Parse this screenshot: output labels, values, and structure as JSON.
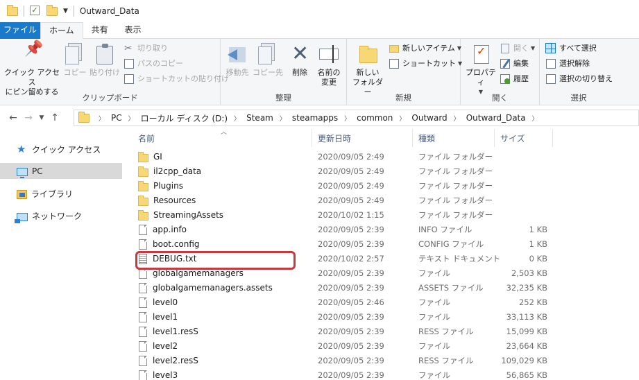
{
  "window": {
    "title": "Outward_Data"
  },
  "tabs": [
    {
      "label": "ファイル",
      "kind": "file"
    },
    {
      "label": "ホーム",
      "kind": "active"
    },
    {
      "label": "共有",
      "kind": ""
    },
    {
      "label": "表示",
      "kind": ""
    }
  ],
  "ribbon": {
    "clipboard": {
      "label": "クリップボード",
      "pin_line1": "クイック アクセス",
      "pin_line2": "にピン留めする",
      "copy": "コピー",
      "paste": "貼り付け",
      "cut": "切り取り",
      "copy_path": "パスのコピー",
      "paste_shortcut": "ショートカットの貼り付け"
    },
    "organize": {
      "label": "整理",
      "move_to": "移動先",
      "copy_to": "コピー先",
      "delete": "削除",
      "rename_line1": "名前の",
      "rename_line2": "変更"
    },
    "new": {
      "label": "新規",
      "new_folder_line1": "新しい",
      "new_folder_line2": "フォルダー",
      "new_item": "新しいアイテム",
      "shortcut": "ショートカット"
    },
    "open": {
      "label": "開く",
      "properties": "プロパティ",
      "open": "開く",
      "edit": "編集",
      "history": "履歴"
    },
    "select": {
      "label": "選択",
      "select_all": "すべて選択",
      "select_none": "選択解除",
      "invert": "選択の切り替え"
    }
  },
  "address": {
    "crumbs": [
      "PC",
      "ローカル ディスク (D:)",
      "Steam",
      "steamapps",
      "common",
      "Outward",
      "Outward_Data"
    ]
  },
  "columns": {
    "name": "名前",
    "date": "更新日時",
    "type": "種類",
    "size": "サイズ"
  },
  "nav": [
    {
      "label": "クイック アクセス",
      "icon": "star-icon"
    },
    {
      "label": "PC",
      "icon": "pc-icon",
      "selected": true
    },
    {
      "label": "ライブラリ",
      "icon": "library-icon"
    },
    {
      "label": "ネットワーク",
      "icon": "network-icon"
    }
  ],
  "files": [
    {
      "name": "GI",
      "date": "2020/09/05 2:49",
      "type": "ファイル フォルダー",
      "size": "",
      "icon": "folder"
    },
    {
      "name": "il2cpp_data",
      "date": "2020/09/05 2:49",
      "type": "ファイル フォルダー",
      "size": "",
      "icon": "folder"
    },
    {
      "name": "Plugins",
      "date": "2020/09/05 2:49",
      "type": "ファイル フォルダー",
      "size": "",
      "icon": "folder"
    },
    {
      "name": "Resources",
      "date": "2020/09/05 2:49",
      "type": "ファイル フォルダー",
      "size": "",
      "icon": "folder"
    },
    {
      "name": "StreamingAssets",
      "date": "2020/10/02 1:15",
      "type": "ファイル フォルダー",
      "size": "",
      "icon": "folder"
    },
    {
      "name": "app.info",
      "date": "2020/09/05 2:39",
      "type": "INFO ファイル",
      "size": "1 KB",
      "icon": "file"
    },
    {
      "name": "boot.config",
      "date": "2020/09/05 2:39",
      "type": "CONFIG ファイル",
      "size": "1 KB",
      "icon": "file"
    },
    {
      "name": "DEBUG.txt",
      "date": "2020/10/02 2:57",
      "type": "テキスト ドキュメント",
      "size": "0 KB",
      "icon": "txt"
    },
    {
      "name": "globalgamemanagers",
      "date": "2020/09/05 2:39",
      "type": "ファイル",
      "size": "2,503 KB",
      "icon": "file"
    },
    {
      "name": "globalgamemanagers.assets",
      "date": "2020/09/05 2:39",
      "type": "ASSETS ファイル",
      "size": "32,235 KB",
      "icon": "file"
    },
    {
      "name": "level0",
      "date": "2020/09/05 2:46",
      "type": "ファイル",
      "size": "252 KB",
      "icon": "file"
    },
    {
      "name": "level1",
      "date": "2020/09/05 2:39",
      "type": "ファイル",
      "size": "33,113 KB",
      "icon": "file"
    },
    {
      "name": "level1.resS",
      "date": "2020/09/05 2:39",
      "type": "RESS ファイル",
      "size": "15,099 KB",
      "icon": "file"
    },
    {
      "name": "level2",
      "date": "2020/09/05 2:39",
      "type": "ファイル",
      "size": "23,664 KB",
      "icon": "file"
    },
    {
      "name": "level2.resS",
      "date": "2020/09/05 2:39",
      "type": "RESS ファイル",
      "size": "109,029 KB",
      "icon": "file"
    },
    {
      "name": "level3",
      "date": "2020/09/05 2:39",
      "type": "ファイル",
      "size": "56,865 KB",
      "icon": "file"
    }
  ]
}
